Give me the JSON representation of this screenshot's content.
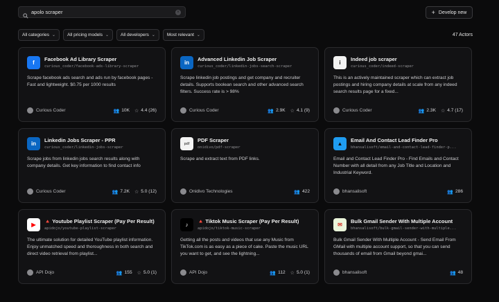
{
  "search": {
    "value": "apolo scraper"
  },
  "header": {
    "develop_label": "Develop new"
  },
  "filters": [
    "All categories",
    "All pricing models",
    "All developers",
    "Most relevant"
  ],
  "count": "47 Actors",
  "cards": [
    {
      "title": "Facebook Ad Library Scraper",
      "slug": "curious_coder/facebook-ads-library-scraper",
      "desc": "Scrape facebook ads search and ads run by facebook pages - Fast and lightweight. $0.75 per 1000 results",
      "author": "Curious Coder",
      "users": "10K",
      "rating": "4.4 (26)",
      "logo": "f",
      "logo_bg": "#1877f2",
      "logo_fg": "#ffffff"
    },
    {
      "title": "Advanced Linkedin Job Scraper",
      "slug": "curious_coder/linkedin-jobs-search-scraper",
      "desc": "Scrape linkedin job postings and get company and recruiter details. Supports boolean search and other advanced search filters. Success rate is > 98%",
      "author": "Curious Coder",
      "users": "2.9K",
      "rating": "4.1 (9)",
      "logo": "in",
      "logo_bg": "#0a66c2",
      "logo_fg": "#ffffff"
    },
    {
      "title": "Indeed job scraper",
      "slug": "curious_coder/indeed-scraper",
      "desc": "This is an actively maintained scraper which can extract job postings and hiring company details at scale from any indeed search results page for a fixed...",
      "author": "Curious Coder",
      "users": "2.3K",
      "rating": "4.7 (17)",
      "logo": "i",
      "logo_bg": "#f2f2f2",
      "logo_fg": "#111111"
    },
    {
      "title": "Linkedin Jobs Scraper - PPR",
      "slug": "curious_coder/linkedin-jobs-scraper",
      "desc": "Scrape jobs from linkedin jobs search results along with company details. Get key information to find contact info",
      "author": "Curious Coder",
      "users": "7.2K",
      "rating": "5.0 (12)",
      "logo": "in",
      "logo_bg": "#0a66c2",
      "logo_fg": "#ffffff"
    },
    {
      "title": "PDF Scraper",
      "slug": "onidivo/pdf-scraper",
      "desc": "Scrape and extract text from PDF links.",
      "author": "Onidivo Technologies",
      "users": "422",
      "rating": "",
      "logo": "pdf",
      "logo_bg": "#f3f3f3",
      "logo_fg": "#555555"
    },
    {
      "title": "Email And Contact Lead Finder Pro",
      "slug": "bhansalisoft/email-and-contact-lead-finder-p...",
      "desc": "Email and Contact Lead Finder Pro - Find Emails and Contact Number with all detail from any Job Title and Location and Industrial Keyword.",
      "author": "bhansalisoft",
      "users": "286",
      "rating": "",
      "logo": "▲",
      "logo_bg": "#1f9cf0",
      "logo_fg": "#0b0b0c"
    },
    {
      "title": "🔺 Youtube Playlist Scraper (Pay Per Result)",
      "slug": "apidojo/youtube-playlist-scraper",
      "desc": "The ultimate solution for detailed YouTube playlist information. Enjoy unmatched speed and thoroughness in both search and direct video retrieval from playlist...",
      "author": "API Dojo",
      "users": "155",
      "rating": "5.0 (1)",
      "logo": "▶",
      "logo_bg": "#ffffff",
      "logo_fg": "#ff0000"
    },
    {
      "title": "🔺 Tiktok Music Scraper (Pay Per Result)",
      "slug": "apidojo/tiktok-music-scraper",
      "desc": "Getting all the posts and videos that use any Music from TikTok.com is as easy as a piece of cake. Paste the music URL you want to get, and see the lightning...",
      "author": "API Dojo",
      "users": "112",
      "rating": "5.0 (1)",
      "logo": "♪",
      "logo_bg": "#000000",
      "logo_fg": "#ffffff"
    },
    {
      "title": "Bulk Gmail Sender With Multiple Account",
      "slug": "bhansalisoft/bulk-gmail-sender-with-multiple...",
      "desc": "Bulk Gmail Sender With Multiple Account - Send Email From GMail with multiple account support, so that you can send thousands of email from Gmail beyond gmai...",
      "author": "bhansalisoft",
      "users": "48",
      "rating": "",
      "logo": "✉",
      "logo_bg": "#e9f4da",
      "logo_fg": "#d43b2f"
    }
  ]
}
